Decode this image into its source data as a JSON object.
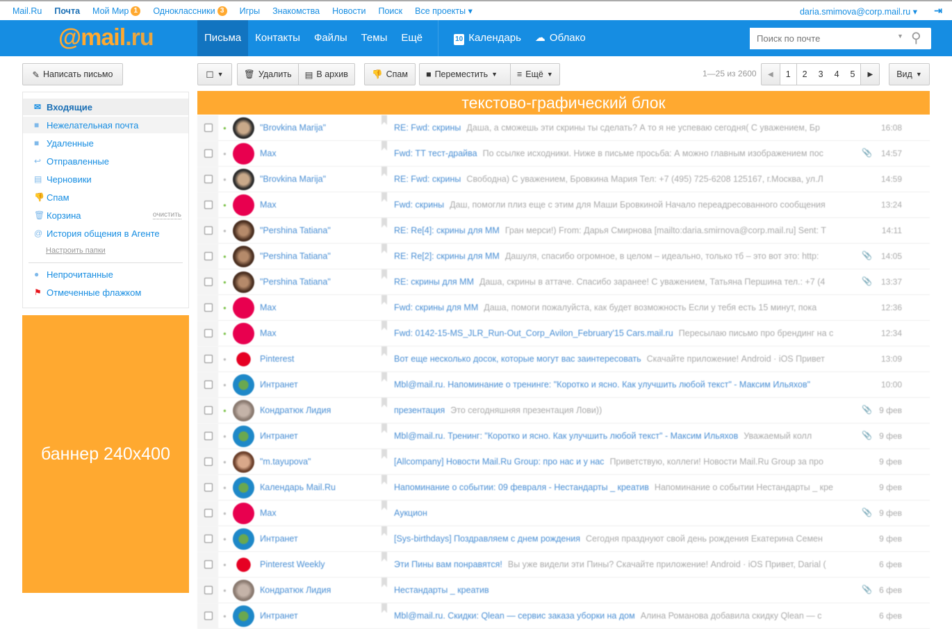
{
  "topbar": {
    "links": [
      {
        "label": "Mail.Ru"
      },
      {
        "label": "Почта",
        "bold": true
      },
      {
        "label": "Мой Мир",
        "badge": "1"
      },
      {
        "label": "Одноклассники",
        "badge": "3"
      },
      {
        "label": "Игры"
      },
      {
        "label": "Знакомства"
      },
      {
        "label": "Новости"
      },
      {
        "label": "Поиск"
      },
      {
        "label": "Все проекты ▾"
      }
    ],
    "user": "daria.smimova@corp.mail.ru ▾",
    "logout_icon": "logout-icon"
  },
  "header": {
    "logo_at": "@mail",
    "logo_ru": ".ru",
    "nav": [
      "Письма",
      "Контакты",
      "Файлы",
      "Темы",
      "Ещё"
    ],
    "calendar": "Календарь",
    "calendar_day": "10",
    "cloud": "Облако",
    "search_placeholder": "Поиск по почте"
  },
  "toolbar": {
    "compose": "Написать письмо",
    "delete": "Удалить",
    "archive": "В архив",
    "spam": "Спам",
    "move": "Переместить",
    "more": "Ещё",
    "count": "1—25 из 2600",
    "pages": [
      "1",
      "2",
      "3",
      "4",
      "5"
    ],
    "view": "Вид"
  },
  "sidebar": {
    "folders": [
      {
        "label": "Входящие",
        "icon": "envelope-icon"
      },
      {
        "label": "Нежелательная почта",
        "icon": "folder-icon"
      },
      {
        "label": "Удаленные",
        "icon": "folder-icon"
      },
      {
        "label": "Отправленные",
        "icon": "reply-icon"
      },
      {
        "label": "Черновики",
        "icon": "draft-icon"
      },
      {
        "label": "Спам",
        "icon": "thumbs-down-icon"
      },
      {
        "label": "Корзина",
        "icon": "trash-icon"
      },
      {
        "label": "История общения в Агенте",
        "icon": "at-icon"
      }
    ],
    "clear": "очистить",
    "setup": "Настроить папки",
    "filters": [
      {
        "label": "Непрочитанные"
      },
      {
        "label": "Отмеченные флажком"
      }
    ]
  },
  "banner": "баннер 240x400",
  "top_block": "текстово-графический блок",
  "colors": {
    "brand": "#168de2",
    "accent": "#ffa930",
    "pink": "#e8004f",
    "teal": "#1e88c8"
  },
  "messages": [
    {
      "from": "\"Brovkina Marija\"",
      "subject": "RE: Fwd: скрины",
      "snippet": "Даша, а сможешь эти скрины ты сделать? А то я не успеваю сегодня( С уважением, Бр",
      "time": "16:08",
      "replied": true,
      "clip": false,
      "av": "photo"
    },
    {
      "from": "Max",
      "subject": "Fwd: ТТ тест-драйва",
      "snippet": "По ссылке исходники. Ниже в письме просьба: А можно главным изображением пос",
      "time": "14:57",
      "replied": false,
      "clip": true,
      "av": "pink"
    },
    {
      "from": "\"Brovkina Marija\"",
      "subject": "RE: Fwd: скрины",
      "snippet": "Свободна) С уважением, Бровкина Мария Тел: +7 (495) 725-6208 125167, г.Москва, ул.Л",
      "time": "14:59",
      "replied": false,
      "clip": false,
      "av": "photo"
    },
    {
      "from": "Max",
      "subject": "Fwd: скрины",
      "snippet": "Даш, помогли плиз еще с этим для Маши Бровкиной Начало переадресованного сообщения",
      "time": "13:24",
      "replied": true,
      "clip": false,
      "av": "pink"
    },
    {
      "from": "\"Pershina Tatiana\"",
      "subject": "RE: Re[4]: скрины для ММ",
      "snippet": "Гран мерси!) From: Дарья Смирнова [mailto:daria.smirnova@corp.mail.ru] Sent: T",
      "time": "14:11",
      "replied": false,
      "clip": false,
      "av": "photo2"
    },
    {
      "from": "\"Pershina Tatiana\"",
      "subject": "RE: Re[2]: скрины для ММ",
      "snippet": "Дашуля, спасибо огромное, в целом – идеально, только тб – это вот это: http:",
      "time": "14:05",
      "replied": true,
      "clip": true,
      "av": "photo2"
    },
    {
      "from": "\"Pershina Tatiana\"",
      "subject": "RE: скрины для ММ",
      "snippet": "Даша, скрины в аттаче. Спасибо заранее! С уважением, Татьяна Першина тел.: +7 (4",
      "time": "13:37",
      "replied": true,
      "clip": true,
      "av": "photo2"
    },
    {
      "from": "Max",
      "subject": "Fwd: скрины для ММ",
      "snippet": "Даша, помоги пожалуйста, как будет возможность Если у тебя есть 15 минут, пока",
      "time": "12:36",
      "replied": true,
      "clip": false,
      "av": "pink"
    },
    {
      "from": "Max",
      "subject": "Fwd: 0142-15-MS_JLR_Run-Out_Corp_Avilon_February'15 Cars.mail.ru",
      "snippet": "Пересылаю письмо про брендинг на с",
      "time": "12:34",
      "replied": true,
      "clip": false,
      "av": "pink"
    },
    {
      "from": "Pinterest",
      "subject": "Вот еще несколько досок, которые могут вас заинтересовать",
      "snippet": "Скачайте приложение! Android · iOS Привет",
      "time": "13:09",
      "replied": false,
      "clip": false,
      "av": "pinterest"
    },
    {
      "from": "Интранет",
      "subject": "Mbl@mail.ru. Напоминание о тренинге: \"Коротко и ясно. Как улучшить любой текст\" - Максим Ильяхов\"",
      "snippet": "",
      "time": "10:00",
      "replied": false,
      "clip": false,
      "av": "teal"
    },
    {
      "from": "Кондратюк Лидия",
      "subject": "презентация",
      "snippet": "Это сегодняшняя презентация Лови))",
      "time": "9 фев",
      "replied": true,
      "clip": true,
      "av": "photo3"
    },
    {
      "from": "Интранет",
      "subject": "Mbl@mail.ru. Тренинг: \"Коротко и ясно. Как улучшить любой текст\" - Максим Ильяхов",
      "snippet": "Уважаемый колл",
      "time": "9 фев",
      "replied": false,
      "clip": true,
      "av": "teal"
    },
    {
      "from": "\"m.tayupova\"",
      "subject": "[Allcompany] Новости Mail.Ru Group: про нас и у нас",
      "snippet": "Приветствую, коллеги! Новости Mail.Ru Group за про",
      "time": "9 фев",
      "replied": false,
      "clip": false,
      "av": "photo4"
    },
    {
      "from": "Календарь Mail.Ru",
      "subject": "Напоминание о событии: 09 февраля - Нестандарты _ креатив",
      "snippet": "Напоминание о событии Нестандарты _ кре",
      "time": "9 фев",
      "replied": false,
      "clip": false,
      "av": "teal"
    },
    {
      "from": "Max",
      "subject": "Аукцион",
      "snippet": "",
      "time": "9 фев",
      "replied": false,
      "clip": true,
      "av": "pink"
    },
    {
      "from": "Интранет",
      "subject": "[Sys-birthdays] Поздравляем с днем рождения",
      "snippet": "Сегодня празднуют свой день рождения Екатерина Семен",
      "time": "9 фев",
      "replied": false,
      "clip": false,
      "av": "teal"
    },
    {
      "from": "Pinterest Weekly",
      "subject": "Эти Пины вам понравятся!",
      "snippet": "Вы уже видели эти Пины? Скачайте приложение! Android · iOS Привет, Darial (",
      "time": "6 фев",
      "replied": false,
      "clip": false,
      "av": "pinterest"
    },
    {
      "from": "Кондратюк Лидия",
      "subject": "Нестандарты _ креатив",
      "snippet": "",
      "time": "6 фев",
      "replied": false,
      "clip": true,
      "av": "photo3"
    },
    {
      "from": "Интранет",
      "subject": "Mbl@mail.ru. Скидки: Qlean — сервис заказа уборки на дом",
      "snippet": "Алина Романова добавила скидку Qlean — с",
      "time": "6 фев",
      "replied": false,
      "clip": false,
      "av": "teal"
    }
  ]
}
